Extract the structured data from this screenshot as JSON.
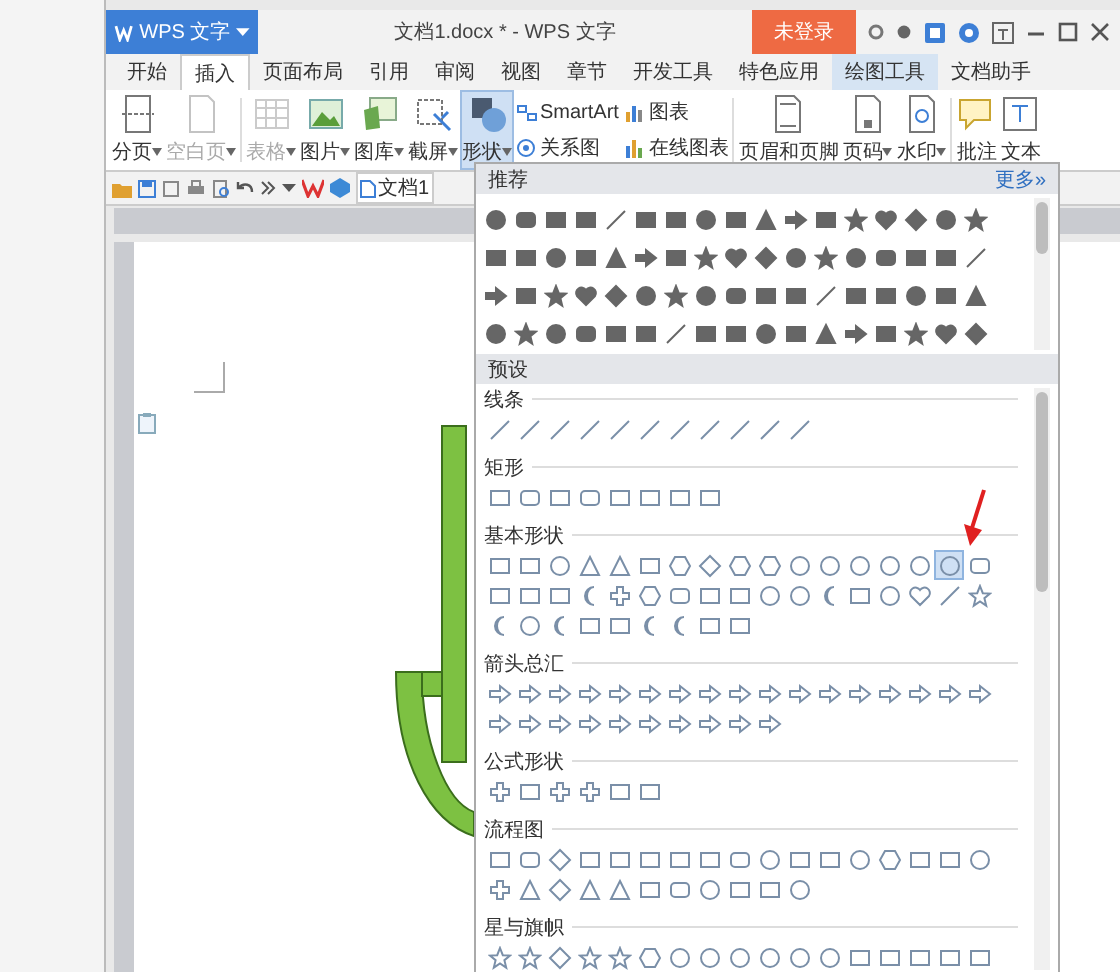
{
  "app_button": {
    "label": "WPS 文字"
  },
  "window": {
    "title": "文档1.docx * - WPS 文字"
  },
  "login_button": {
    "label": "未登录"
  },
  "menu_tabs": [
    {
      "label": "开始",
      "selected": false,
      "contextual": false
    },
    {
      "label": "插入",
      "selected": true,
      "contextual": false
    },
    {
      "label": "页面布局",
      "selected": false,
      "contextual": false
    },
    {
      "label": "引用",
      "selected": false,
      "contextual": false
    },
    {
      "label": "审阅",
      "selected": false,
      "contextual": false
    },
    {
      "label": "视图",
      "selected": false,
      "contextual": false
    },
    {
      "label": "章节",
      "selected": false,
      "contextual": false
    },
    {
      "label": "开发工具",
      "selected": false,
      "contextual": false
    },
    {
      "label": "特色应用",
      "selected": false,
      "contextual": false
    },
    {
      "label": "绘图工具",
      "selected": false,
      "contextual": true
    },
    {
      "label": "文档助手",
      "selected": false,
      "contextual": false
    }
  ],
  "ribbon": [
    {
      "kind": "large",
      "label": "分页",
      "dropdown": true,
      "disabled": false,
      "selected": false
    },
    {
      "kind": "large",
      "label": "空白页",
      "dropdown": true,
      "disabled": true,
      "selected": false
    },
    {
      "kind": "large",
      "label": "表格",
      "dropdown": true,
      "disabled": true,
      "selected": false
    },
    {
      "kind": "large",
      "label": "图片",
      "dropdown": true,
      "disabled": false,
      "selected": false
    },
    {
      "kind": "large",
      "label": "图库",
      "dropdown": true,
      "disabled": false,
      "selected": false
    },
    {
      "kind": "large",
      "label": "截屏",
      "dropdown": true,
      "disabled": false,
      "selected": false
    },
    {
      "kind": "large",
      "label": "形状",
      "dropdown": true,
      "disabled": false,
      "selected": true
    },
    {
      "kind": "small",
      "label": "SmartArt",
      "dropdown": false,
      "disabled": false,
      "selected": false
    },
    {
      "kind": "small",
      "label": "关系图",
      "dropdown": false,
      "disabled": false,
      "selected": false
    },
    {
      "kind": "small",
      "label": "图表",
      "dropdown": false,
      "disabled": false,
      "selected": false
    },
    {
      "kind": "small",
      "label": "在线图表",
      "dropdown": false,
      "disabled": false,
      "selected": false
    },
    {
      "kind": "large",
      "label": "页眉和页脚",
      "dropdown": false,
      "disabled": false,
      "selected": false
    },
    {
      "kind": "large",
      "label": "页码",
      "dropdown": true,
      "disabled": false,
      "selected": false
    },
    {
      "kind": "large",
      "label": "水印",
      "dropdown": true,
      "disabled": false,
      "selected": false
    },
    {
      "kind": "large",
      "label": "批注",
      "dropdown": false,
      "disabled": false,
      "selected": false
    },
    {
      "kind": "large",
      "label": "文本",
      "dropdown": false,
      "disabled": false,
      "selected": false
    }
  ],
  "quick_access": {
    "doc_tab": "文档1"
  },
  "shape_panel": {
    "recommended_title": "推荐",
    "more_link": "更多»",
    "presets_title": "预设",
    "sections": [
      {
        "title": "线条"
      },
      {
        "title": "矩形"
      },
      {
        "title": "基本形状",
        "shapes": [
          {
            "selected": false
          },
          {
            "selected": false
          },
          {
            "selected": false
          },
          {
            "selected": false
          },
          {
            "selected": false
          },
          {
            "selected": false
          },
          {
            "selected": false
          },
          {
            "selected": false
          },
          {
            "selected": false
          },
          {
            "selected": false
          },
          {
            "selected": false
          },
          {
            "selected": false
          },
          {
            "selected": false
          },
          {
            "selected": false
          },
          {
            "selected": false
          },
          {
            "selected": true
          },
          {
            "selected": false
          },
          {
            "selected": false
          },
          {
            "selected": false
          },
          {
            "selected": false
          },
          {
            "selected": false
          },
          {
            "selected": false
          },
          {
            "selected": false
          },
          {
            "selected": false
          },
          {
            "selected": false
          },
          {
            "selected": false
          },
          {
            "selected": false
          },
          {
            "selected": false
          },
          {
            "selected": false
          },
          {
            "selected": false
          },
          {
            "selected": false
          },
          {
            "selected": false
          },
          {
            "selected": false
          },
          {
            "selected": false
          },
          {
            "selected": false
          },
          {
            "selected": false
          },
          {
            "selected": false
          },
          {
            "selected": false
          },
          {
            "selected": false
          },
          {
            "selected": false
          },
          {
            "selected": false
          },
          {
            "selected": false
          },
          {
            "selected": false
          }
        ]
      },
      {
        "title": "箭头总汇"
      },
      {
        "title": "公式形状"
      },
      {
        "title": "流程图"
      },
      {
        "title": "星与旗帜"
      }
    ]
  }
}
